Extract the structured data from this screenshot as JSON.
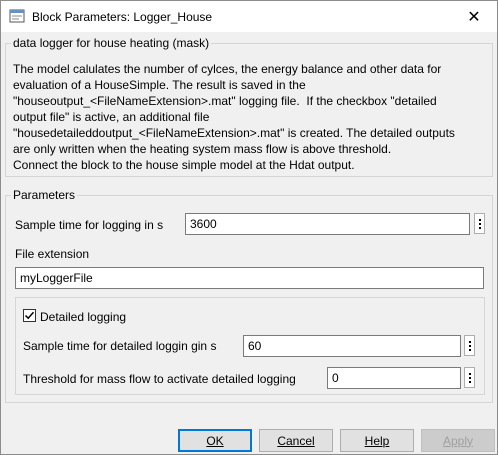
{
  "window": {
    "title": "Block Parameters: Logger_House",
    "close_glyph": "✕"
  },
  "mask": {
    "legend": "data logger for house heating (mask)",
    "description": "The model calulates the number of cylces, the energy balance and other data for\nevaluation of a HouseSimple. The result is saved in the\n\"houseoutput_<FileNameExtension>.mat\" logging file.  If the checkbox \"detailed\noutput file\" is active, an additional file\n\"housedetaileddoutput_<FileNameExtension>.mat\" is created. The detailed outputs\nare only written when the heating system mass flow is above threshold.\nConnect the block to the house simple model at the Hdat output."
  },
  "parameters": {
    "legend": "Parameters",
    "sample_time_label": "Sample time for logging in s",
    "sample_time_value": "3600",
    "file_ext_label": "File extension",
    "file_ext_value": "myLoggerFile",
    "detailed": {
      "checkbox_label": "Detailed logging",
      "checked": true,
      "sample_time_label": "Sample time for detailed loggin gin s",
      "sample_time_value": "60",
      "threshold_label": "Threshold for mass flow to activate detailed logging",
      "threshold_value": "0"
    }
  },
  "buttons": {
    "ok": "OK",
    "cancel": "Cancel",
    "help": "Help",
    "apply": "Apply"
  },
  "colors": {
    "accent": "#0078d7",
    "window_bg": "#f0f0f0"
  }
}
